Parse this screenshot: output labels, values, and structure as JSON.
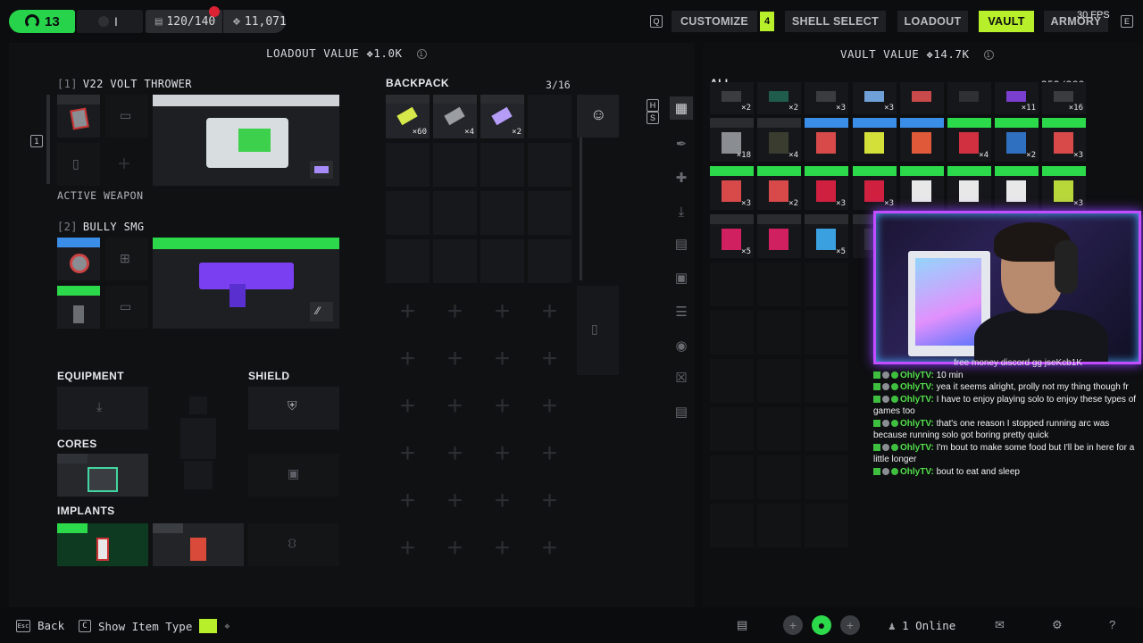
{
  "topbar": {
    "level": "13",
    "rank": "I",
    "storage": "120/140",
    "currency": "11,071",
    "currency_icon": "coin-icon",
    "key_left": "Q",
    "key_right": "E",
    "fps": "30 FPS",
    "tabs": [
      {
        "label": "CUSTOMIZE",
        "active": false
      },
      {
        "label": "SHELL SELECT",
        "active": false
      },
      {
        "label": "LOADOUT",
        "active": false
      },
      {
        "label": "VAULT",
        "active": true
      },
      {
        "label": "ARMORY",
        "active": false
      }
    ],
    "customize_badge": "4",
    "accent_color": "#b7f02a"
  },
  "loadout": {
    "header": "LOADOUT VALUE",
    "value": "1.0K",
    "weapons": [
      {
        "index": "[1]",
        "name": "V22 VOLT THROWER",
        "status": "ACTIVE WEAPON"
      },
      {
        "index": "[2]",
        "name": "BULLY SMG"
      }
    ],
    "sections": {
      "equipment": "EQUIPMENT",
      "shield": "SHIELD",
      "cores": "CORES",
      "implants": "IMPLANTS"
    },
    "slot_key": "1"
  },
  "backpack": {
    "title": "BACKPACK",
    "capacity": "3/16",
    "items": [
      {
        "qty": "×60",
        "icon": "ammo-icon"
      },
      {
        "qty": "×4",
        "icon": "syringe-icon"
      },
      {
        "qty": "×2",
        "icon": "battery-icon"
      }
    ]
  },
  "vault": {
    "header": "VAULT VALUE",
    "value": "14.7K",
    "filter": "ALL",
    "capacity": "252/288",
    "row1_qty": [
      "×2",
      "×2",
      "×3",
      "×3",
      "",
      "",
      "×11",
      "×16"
    ],
    "row2_qty": [
      "×18",
      "×4",
      "",
      "",
      "",
      "×4",
      "×2",
      "×3"
    ],
    "row3_qty": [
      "×3",
      "×2",
      "×3",
      "×3",
      "",
      "",
      "",
      "×3"
    ],
    "row4_qty": [
      "×5",
      "",
      "×5",
      ""
    ]
  },
  "side_keys": {
    "top": "H",
    "bottom": "S"
  },
  "chat": {
    "messages": [
      {
        "user": "",
        "text": "free money discord gg jseKcb1K"
      },
      {
        "user": "OhlyTV:",
        "text": "10 min"
      },
      {
        "user": "OhlyTV:",
        "text": "yea it seems alright, prolly not my thing though fr"
      },
      {
        "user": "OhlyTV:",
        "text": "I have to enjoy playing solo to enjoy these types of games too"
      },
      {
        "user": "OhlyTV:",
        "text": "that's one reason I stopped running arc was because running solo got boring pretty quick"
      },
      {
        "user": "OhlyTV:",
        "text": "I'm bout to make some food but I'll be in here for a little longer"
      },
      {
        "user": "OhlyTV:",
        "text": "bout to eat and sleep"
      }
    ]
  },
  "bottombar": {
    "back_key": "Esc",
    "back_label": "Back",
    "show_key": "C",
    "show_label": "Show Item Type",
    "online": "1 Online"
  }
}
